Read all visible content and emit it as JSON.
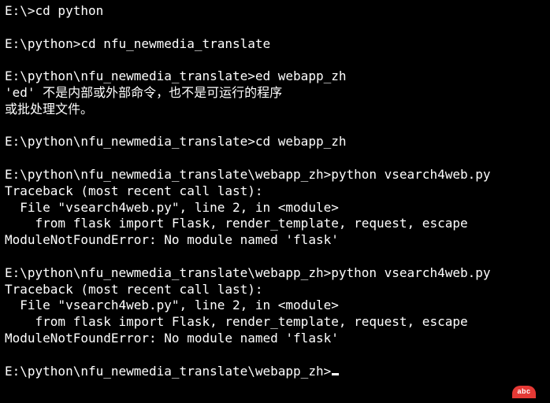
{
  "lines": [
    "E:\\>cd python",
    "",
    "E:\\python>cd nfu_newmedia_translate",
    "",
    "E:\\python\\nfu_newmedia_translate>ed webapp_zh",
    "'ed' 不是内部或外部命令，也不是可运行的程序",
    "或批处理文件。",
    "",
    "E:\\python\\nfu_newmedia_translate>cd webapp_zh",
    "",
    "E:\\python\\nfu_newmedia_translate\\webapp_zh>python vsearch4web.py",
    "Traceback (most recent call last):",
    "  File \"vsearch4web.py\", line 2, in <module>",
    "    from flask import Flask, render_template, request, escape",
    "ModuleNotFoundError: No module named 'flask'",
    "",
    "E:\\python\\nfu_newmedia_translate\\webapp_zh>python vsearch4web.py",
    "Traceback (most recent call last):",
    "  File \"vsearch4web.py\", line 2, in <module>",
    "    from flask import Flask, render_template, request, escape",
    "ModuleNotFoundError: No module named 'flask'",
    "",
    "E:\\python\\nfu_newmedia_translate\\webapp_zh>"
  ],
  "badge_text": "abc"
}
